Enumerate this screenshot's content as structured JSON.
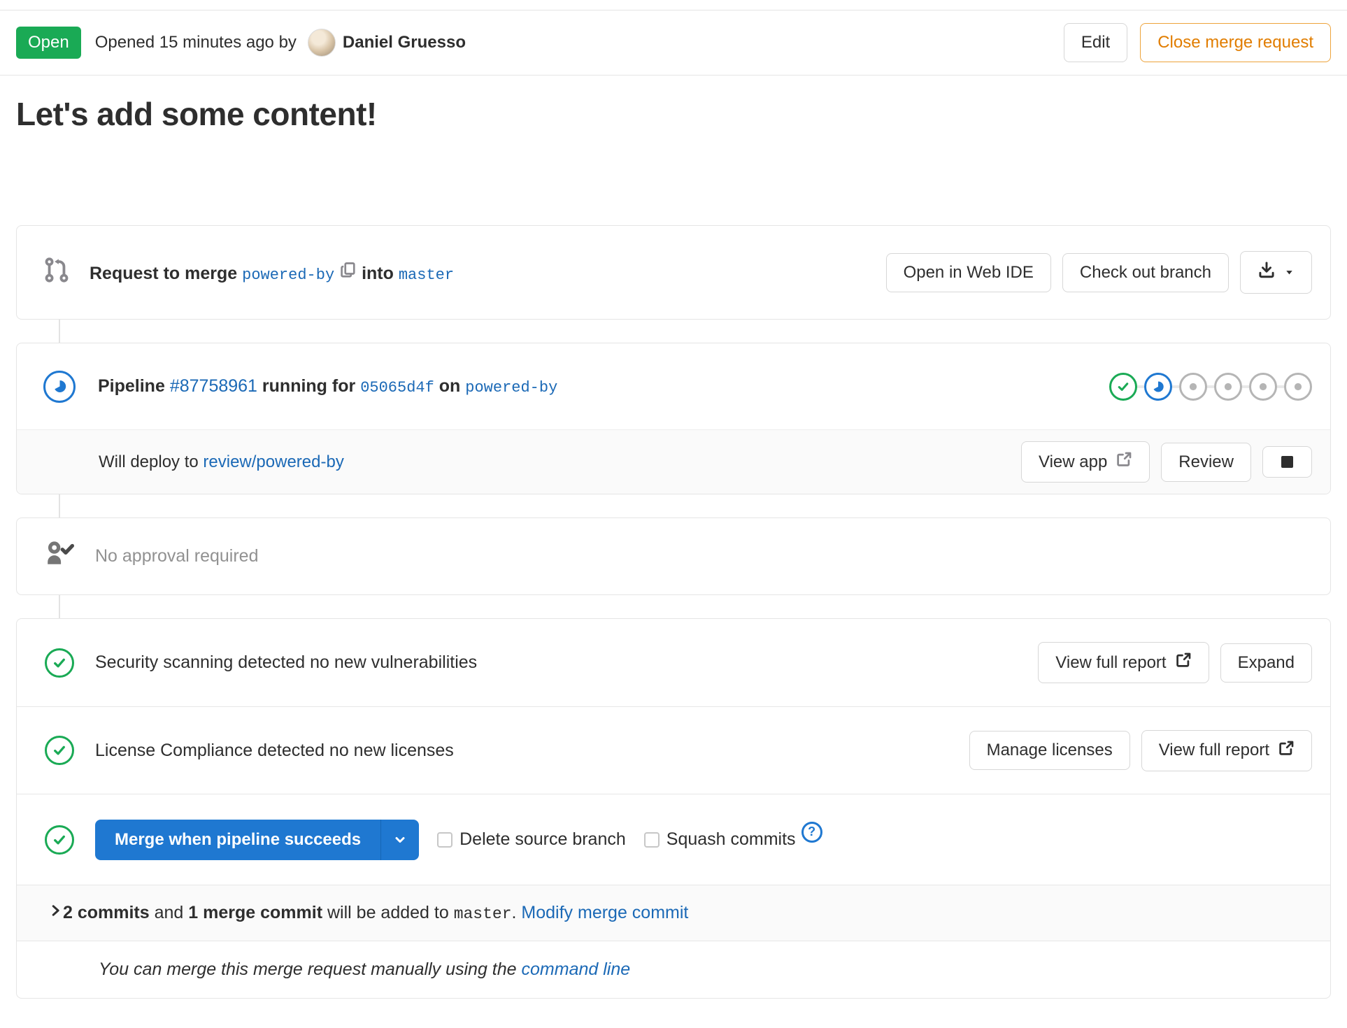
{
  "colors": {
    "status_green": "#1aaa55",
    "link_blue": "#1b69b6",
    "button_blue": "#1f78d1",
    "close_orange": "#e17d00",
    "muted_gray": "#919191"
  },
  "header": {
    "status": "Open",
    "opened_text": "Opened 15 minutes ago by",
    "author": "Daniel Gruesso",
    "edit": "Edit",
    "close": "Close merge request"
  },
  "title": "Let's add some content!",
  "merge_info": {
    "request_label": "Request to merge",
    "source_branch": "powered-by",
    "into_label": "into",
    "target_branch": "master",
    "open_web_ide": "Open in Web IDE",
    "check_out_branch": "Check out branch"
  },
  "pipeline": {
    "label": "Pipeline",
    "id": "#87758961",
    "running_for": "running for",
    "commit": "05065d4f",
    "on_label": "on",
    "branch": "powered-by",
    "stages": [
      "success",
      "running",
      "pending",
      "pending",
      "pending",
      "pending"
    ],
    "deploy": {
      "prefix": "Will deploy to",
      "environment": "review/powered-by",
      "view_app": "View app",
      "review": "Review"
    }
  },
  "approval": {
    "message": "No approval required"
  },
  "security": {
    "message": "Security scanning detected no new vulnerabilities",
    "view_full_report": "View full report",
    "expand": "Expand"
  },
  "license": {
    "message": "License Compliance detected no new licenses",
    "manage_licenses": "Manage licenses",
    "view_full_report": "View full report"
  },
  "merge_controls": {
    "merge_button": "Merge when pipeline succeeds",
    "delete_source_branch": "Delete source branch",
    "squash_commits": "Squash commits"
  },
  "commits": {
    "count": "2 commits",
    "and_label": "and",
    "merge_commit": "1 merge commit",
    "added_to": "will be added to",
    "target": "master",
    "period": ".",
    "modify_link": "Modify merge commit"
  },
  "footer": {
    "message": "You can merge this merge request manually using the",
    "command_line_link": "command line"
  }
}
